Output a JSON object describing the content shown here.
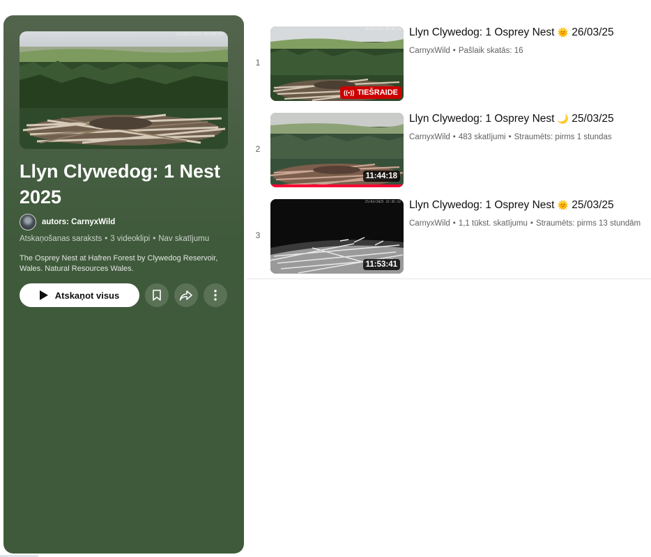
{
  "playlist": {
    "title": "Llyn Clywedog: 1 Nest 2025",
    "owner": "autors: CarnyxWild",
    "type": "Atskaņošanas saraksts",
    "video_count": "3 videoklipi",
    "views": "Nav skatījumu",
    "separator": "•",
    "description": "The Osprey Nest at Hafren Forest by Clywedog Reservoir, Wales. Natural Resources Wales.",
    "play_all_label": "Atskaņot visus",
    "thumbnail_timestamp": "26/03/2025 09:09:25",
    "icons": {
      "play": "play-icon",
      "save": "bookmark-icon",
      "share": "share-icon",
      "more": "more-vert-icon"
    },
    "panel_color": "#3f5a3b"
  },
  "videos": [
    {
      "index": "1",
      "title_prefix": "Llyn Clywedog: 1 Osprey Nest",
      "emoji": "🌞",
      "date": "26/03/25",
      "channel": "CarnyxWild",
      "stat": "Pašlaik skatās: 16",
      "age": "",
      "badge": "TIEŠRAIDE",
      "duration": "",
      "live": true,
      "thumb_timestamp": "26/03/2025 09:09:26"
    },
    {
      "index": "2",
      "title_prefix": "Llyn Clywedog: 1 Osprey Nest",
      "emoji": "🌙",
      "date": "25/03/25",
      "channel": "CarnyxWild",
      "stat": "483 skatījumi",
      "age": "Straumēts: pirms 1 stundas",
      "badge": "",
      "duration": "11:44:18",
      "live": false,
      "watched_fraction": 1.0
    },
    {
      "index": "3",
      "title_prefix": "Llyn Clywedog: 1 Osprey Nest",
      "emoji": "🌞",
      "date": "25/03/25",
      "channel": "CarnyxWild",
      "stat": "1,1 tūkst. skatījumu",
      "age": "Straumēts: pirms 13 stundām",
      "badge": "",
      "duration": "11:53:41",
      "live": false,
      "thumb_timestamp": "25/03/2025 22:45:12"
    }
  ],
  "colors": {
    "live_red": "#cc0000",
    "progress_red": "#ff0033"
  }
}
